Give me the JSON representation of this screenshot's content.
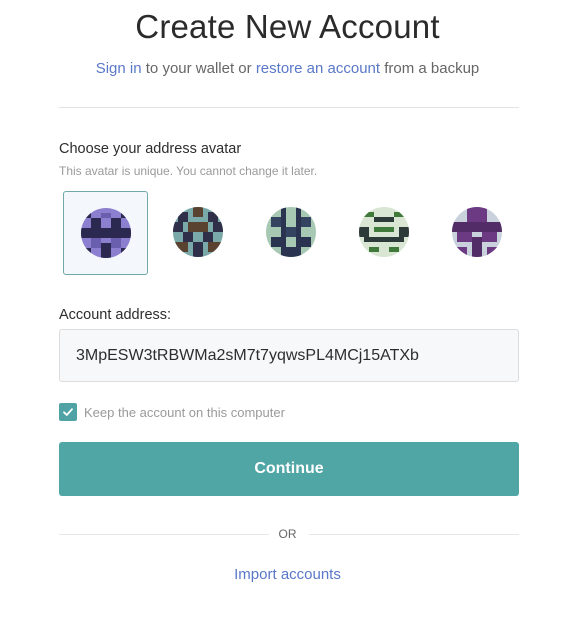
{
  "header": {
    "title": "Create New Account",
    "sign_in_link": "Sign in",
    "text_middle": " to your wallet or ",
    "restore_link": "restore an account",
    "text_end": " from a backup"
  },
  "avatar_section": {
    "label": "Choose your address avatar",
    "note": "This avatar is unique. You cannot change it later.",
    "selected_index": 0,
    "avatars": [
      {
        "name": "avatar-1",
        "bg": "#8d7fcf",
        "fg": "#2b2950",
        "accent": "#6a5fae"
      },
      {
        "name": "avatar-2",
        "bg": "#7aa9aa",
        "fg": "#2f2f4a",
        "accent": "#5a4230"
      },
      {
        "name": "avatar-3",
        "bg": "#a7c9b4",
        "fg": "#2a3450",
        "accent": "#34435f"
      },
      {
        "name": "avatar-4",
        "bg": "#d8e6d3",
        "fg": "#3f7a3a",
        "accent": "#2d3a3a"
      },
      {
        "name": "avatar-5",
        "bg": "#c9d2dc",
        "fg": "#6b3a82",
        "accent": "#522c66"
      }
    ]
  },
  "address": {
    "label": "Account address:",
    "value": "3MpESW3tRBWMa2sM7t7yqwsPL4MCj15ATXb"
  },
  "keep_account": {
    "label": "Keep the account on this computer",
    "checked": true
  },
  "continue_label": "Continue",
  "or_label": "OR",
  "import_label": "Import accounts",
  "colors": {
    "accent": "#50a5a5",
    "link": "#5a78c8"
  }
}
